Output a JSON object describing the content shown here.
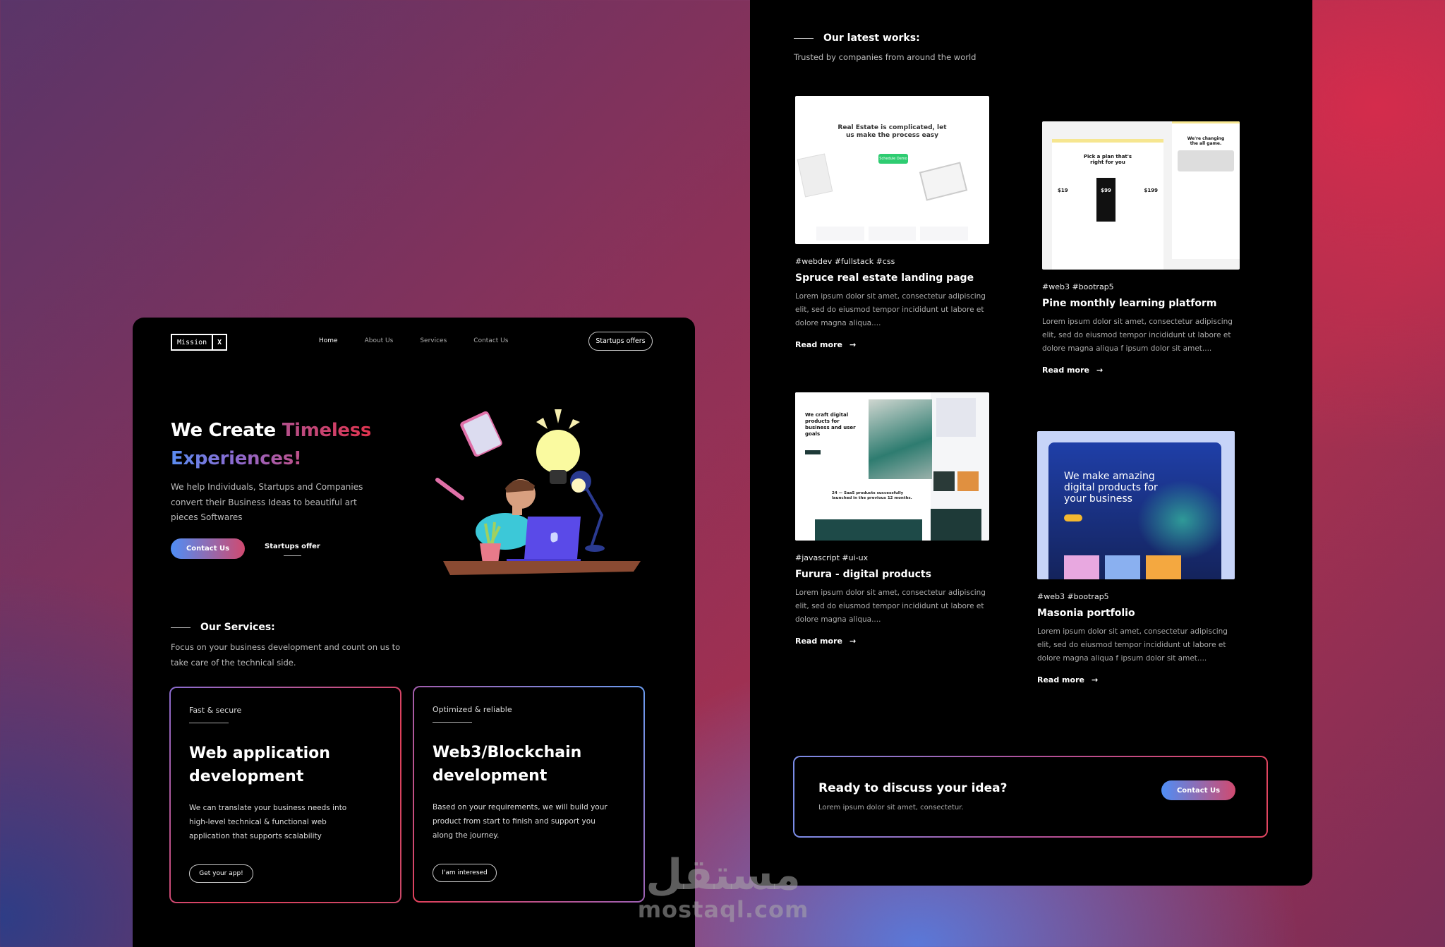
{
  "left_page": {
    "logo": {
      "name": "Mission",
      "mark": "X"
    },
    "nav": [
      {
        "label": "Home",
        "active": true
      },
      {
        "label": "About Us",
        "active": false
      },
      {
        "label": "Services",
        "active": false
      },
      {
        "label": "Contact Us",
        "active": false
      }
    ],
    "nav_cta": "Startups offers",
    "hero": {
      "title_part1": "We Create ",
      "title_highlight1": "Timeless",
      "title_highlight2": "Experiences!",
      "subtitle": "We help Individuals, Startups and Companies convert their Business Ideas to beautiful art pieces Softwares",
      "primary_button": "Contact Us",
      "secondary_button": "Startups offer",
      "illustration": "person-at-laptop-with-lightbulb-illustration"
    },
    "services": {
      "heading": "Our Services:",
      "subtitle": "Focus on your business development and count on us to take care of the technical side.",
      "cards": [
        {
          "tag": "Fast & secure",
          "title": "Web application development",
          "description": "We can translate your business needs into high-level technical & functional web application that supports scalability",
          "button": "Get your app!"
        },
        {
          "tag": "Optimized & reliable",
          "title": "Web3/Blockchain development",
          "description": "Based on your requirements, we will build your product from start to finish and support you along the journey.",
          "button": "I'am interesed"
        }
      ]
    }
  },
  "right_page": {
    "works": {
      "heading": "Our latest works:",
      "subtitle": "Trusted by companies from around the world",
      "read_more": "Read more",
      "items": [
        {
          "tags": "#webdev #fullstack #css",
          "title": "Spruce real estate landing page",
          "description": "Lorem ipsum dolor sit amet, consectetur adipiscing elit, sed do eiusmod tempor incididunt ut labore et dolore magna aliqua....",
          "thumb_headline": "Real Estate is complicated, let us make the process easy",
          "thumb_button": "Schedule Demo"
        },
        {
          "tags": "#web3 #bootrap5",
          "title": "Pine monthly learning platform",
          "description": "Lorem ipsum dolor sit amet, consectetur adipiscing elit, sed do eiusmod tempor incididunt ut labore et dolore magna aliqua f ipsum dolor sit amet....",
          "thumb_headline": "Pick a plan that's right for you",
          "thumb_prices": [
            "$19",
            "$99",
            "$199"
          ],
          "thumb_side": "We're changing the all game."
        },
        {
          "tags": "#javascript #ui-ux",
          "title": "Furura - digital products",
          "description": "Lorem ipsum dolor sit amet, consectetur adipiscing elit, sed do eiusmod tempor incididunt ut labore et dolore magna aliqua....",
          "thumb_headline": "We craft digital products for business and user goals",
          "thumb_stat": "24 — SaaS products successfully launched in the previous 12 months."
        },
        {
          "tags": "#web3 #bootrap5",
          "title": "Masonia portfolio",
          "description": "Lorem ipsum dolor sit amet, consectetur adipiscing elit, sed do eiusmod tempor incididunt ut labore et dolore magna aliqua f ipsum dolor sit amet....",
          "thumb_headline": "We make amazing digital products for your business"
        }
      ]
    },
    "cta": {
      "title": "Ready to discuss your idea?",
      "subtitle": "Lorem ipsum dolor sit amet, consectetur.",
      "button": "Contact Us"
    }
  },
  "watermark": {
    "arabic": "مستقل",
    "latin": "mostaql.com"
  },
  "colors": {
    "accent_blue": "#4f8ef5",
    "accent_red": "#e0405a",
    "panel_bg": "#000000"
  }
}
